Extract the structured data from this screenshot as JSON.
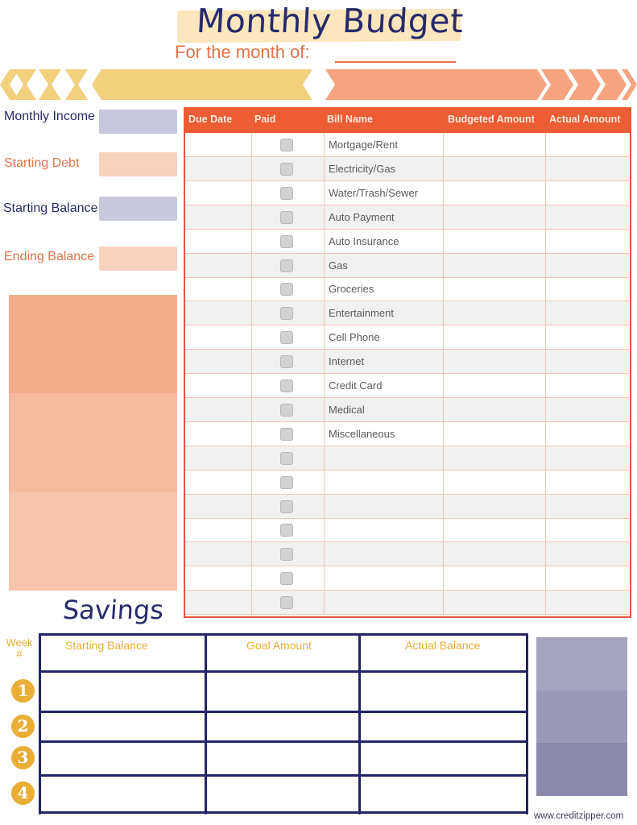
{
  "header": {
    "title": "Monthly Budget",
    "month_label": "For the month of:",
    "month_value": ""
  },
  "colors": {
    "navy": "#272a6b",
    "orange": "#e0744a",
    "header_red": "#ec5d35",
    "yellow": "#f2d07e",
    "peach": "#f4a580",
    "gold": "#e9ae35",
    "lavender": "#c8c8dc"
  },
  "summary": [
    {
      "label": "Monthly Income",
      "value": ""
    },
    {
      "label": "Starting Debt",
      "value": ""
    },
    {
      "label": "Starting Balance",
      "value": ""
    },
    {
      "label": "Ending Balance",
      "value": ""
    }
  ],
  "bills": {
    "columns": [
      "Due Date",
      "Paid",
      "Bill Name",
      "Budgeted Amount",
      "Actual Amount"
    ],
    "rows": [
      {
        "due": "",
        "paid": false,
        "name": "Mortgage/Rent",
        "budgeted": "",
        "actual": ""
      },
      {
        "due": "",
        "paid": false,
        "name": "Electricity/Gas",
        "budgeted": "",
        "actual": ""
      },
      {
        "due": "",
        "paid": false,
        "name": "Water/Trash/Sewer",
        "budgeted": "",
        "actual": ""
      },
      {
        "due": "",
        "paid": false,
        "name": "Auto Payment",
        "budgeted": "",
        "actual": ""
      },
      {
        "due": "",
        "paid": false,
        "name": "Auto Insurance",
        "budgeted": "",
        "actual": ""
      },
      {
        "due": "",
        "paid": false,
        "name": "Gas",
        "budgeted": "",
        "actual": ""
      },
      {
        "due": "",
        "paid": false,
        "name": "Groceries",
        "budgeted": "",
        "actual": ""
      },
      {
        "due": "",
        "paid": false,
        "name": "Entertainment",
        "budgeted": "",
        "actual": ""
      },
      {
        "due": "",
        "paid": false,
        "name": "Cell Phone",
        "budgeted": "",
        "actual": ""
      },
      {
        "due": "",
        "paid": false,
        "name": "Internet",
        "budgeted": "",
        "actual": ""
      },
      {
        "due": "",
        "paid": false,
        "name": "Credit Card",
        "budgeted": "",
        "actual": ""
      },
      {
        "due": "",
        "paid": false,
        "name": "Medical",
        "budgeted": "",
        "actual": ""
      },
      {
        "due": "",
        "paid": false,
        "name": "Miscellaneous",
        "budgeted": "",
        "actual": ""
      },
      {
        "due": "",
        "paid": false,
        "name": "",
        "budgeted": "",
        "actual": ""
      },
      {
        "due": "",
        "paid": false,
        "name": "",
        "budgeted": "",
        "actual": ""
      },
      {
        "due": "",
        "paid": false,
        "name": "",
        "budgeted": "",
        "actual": ""
      },
      {
        "due": "",
        "paid": false,
        "name": "",
        "budgeted": "",
        "actual": ""
      },
      {
        "due": "",
        "paid": false,
        "name": "",
        "budgeted": "",
        "actual": ""
      },
      {
        "due": "",
        "paid": false,
        "name": "",
        "budgeted": "",
        "actual": ""
      },
      {
        "due": "",
        "paid": false,
        "name": "",
        "budgeted": "",
        "actual": ""
      }
    ]
  },
  "savings": {
    "title": "Savings",
    "week_label": "Week #",
    "columns": [
      "Starting Balance",
      "Goal Amount",
      "Actual Balance"
    ],
    "weeks": [
      {
        "week": "1",
        "starting": "",
        "goal": "",
        "actual": ""
      },
      {
        "week": "2",
        "starting": "",
        "goal": "",
        "actual": ""
      },
      {
        "week": "3",
        "starting": "",
        "goal": "",
        "actual": ""
      },
      {
        "week": "4",
        "starting": "",
        "goal": "",
        "actual": ""
      }
    ]
  },
  "footer": {
    "url": "www.creditzipper.com"
  }
}
